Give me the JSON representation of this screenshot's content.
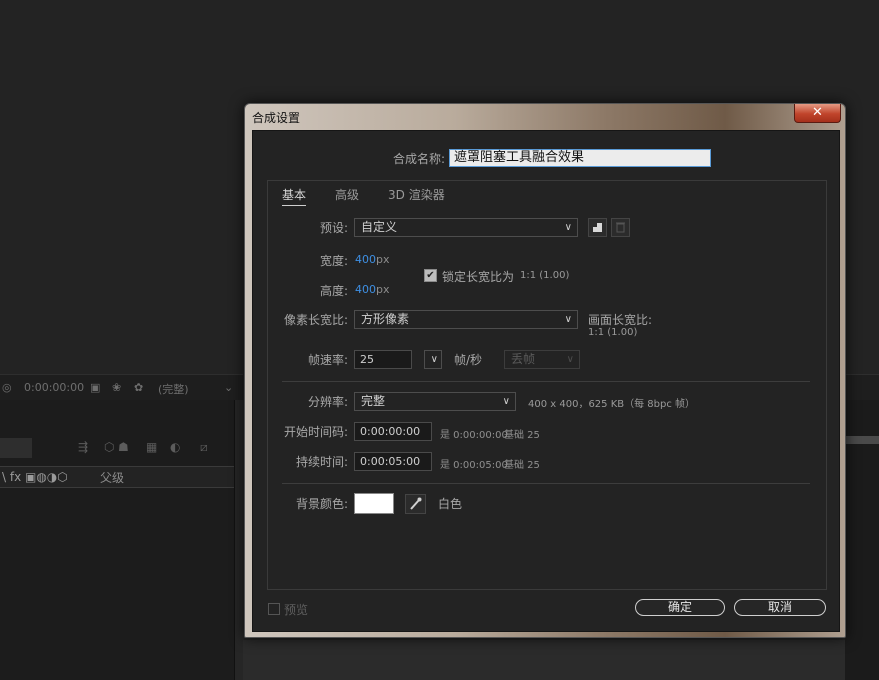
{
  "background": {
    "toolbar": {
      "timecode": "0:00:00:00",
      "quality": "(完整)"
    },
    "timeline": {
      "column_parent": "父级"
    }
  },
  "dialog": {
    "title": "合成设置",
    "close_glyph": "✕",
    "comp_name_label": "合成名称:",
    "comp_name_value": "遮罩阻塞工具融合效果",
    "tabs": [
      "基本",
      "高级",
      "3D 渲染器"
    ],
    "preset": {
      "label": "预设:",
      "value": "自定义"
    },
    "width": {
      "label": "宽度:",
      "value": "400",
      "unit": "px"
    },
    "height": {
      "label": "高度:",
      "value": "400",
      "unit": "px"
    },
    "lock_aspect": {
      "label": "锁定长宽比为",
      "ratio": "1:1 (1.00)",
      "checked": true
    },
    "pixel_aspect": {
      "label": "像素长宽比:",
      "value": "方形像素"
    },
    "frame_aspect": {
      "label": "画面长宽比:",
      "value": "1:1 (1.00)"
    },
    "frame_rate": {
      "label": "帧速率:",
      "value": "25",
      "unit": "帧/秒",
      "drop_frame": "丢帧"
    },
    "resolution": {
      "label": "分辨率:",
      "value": "完整",
      "info": "400 x 400，625 KB（每 8bpc 帧）"
    },
    "start_timecode": {
      "label": "开始时间码:",
      "value": "0:00:00:00",
      "is_label": "是 0:00:00:00",
      "base": "基础 25"
    },
    "duration": {
      "label": "持续时间:",
      "value": "0:00:05:00",
      "is_label": "是 0:00:05:00",
      "base": "基础 25"
    },
    "bg_color": {
      "label": "背景颜色:",
      "name": "白色",
      "swatch": "#ffffff"
    },
    "preview_label": "预览",
    "ok_label": "确定",
    "cancel_label": "取消"
  },
  "colors": {
    "accent_blue": "#3e8fe3",
    "close_red": "#c0442b"
  }
}
